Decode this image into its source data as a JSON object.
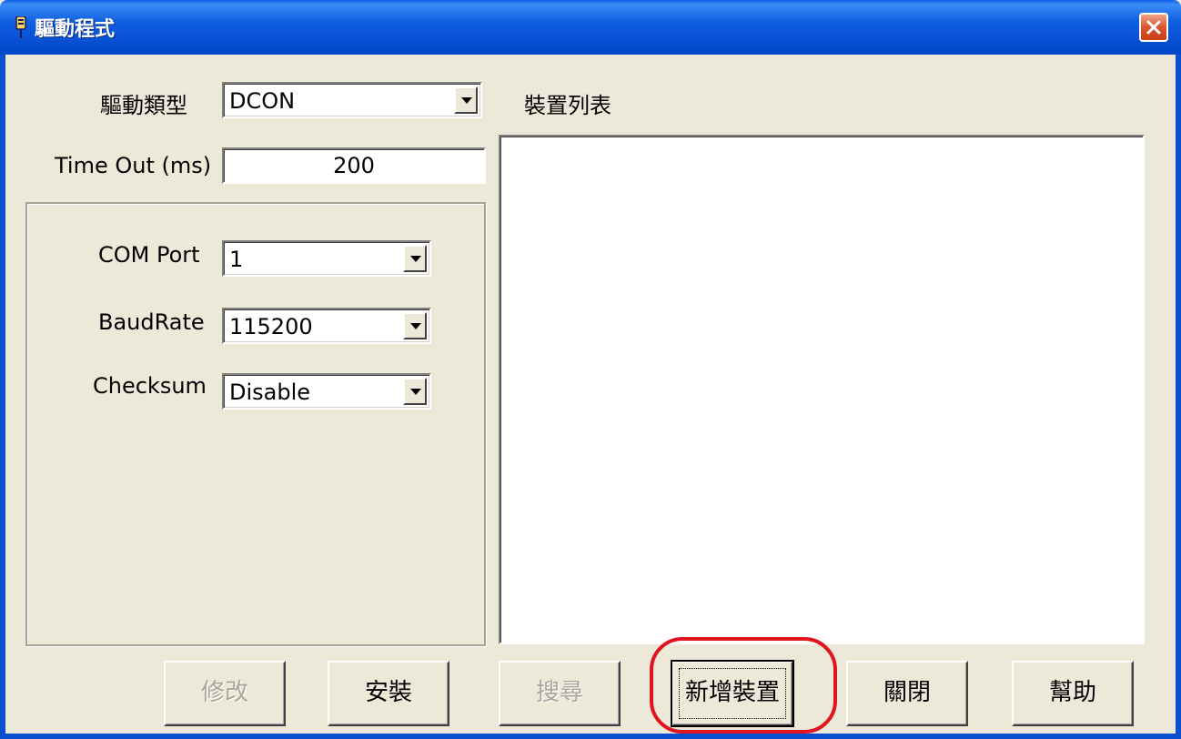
{
  "window": {
    "title": "驅動程式",
    "title_icon": "driver-plug-icon",
    "close_icon": "close-icon"
  },
  "driver_type": {
    "label": "驅動類型",
    "value": "DCON"
  },
  "timeout": {
    "label": "Time Out (ms)",
    "value": "200"
  },
  "com_port": {
    "label": "COM Port",
    "value": "1"
  },
  "baudrate": {
    "label": "BaudRate",
    "value": "115200"
  },
  "checksum": {
    "label": "Checksum",
    "value": "Disable"
  },
  "device_list": {
    "label": "裝置列表",
    "items": []
  },
  "buttons": {
    "modify": "修改",
    "install": "安裝",
    "search": "搜尋",
    "add_device": "新增裝置",
    "close": "關閉",
    "help": "幫助"
  },
  "colors": {
    "title_bar": "#0a52d6",
    "window_bg": "#ece9d8",
    "highlight": "#e0151f"
  }
}
